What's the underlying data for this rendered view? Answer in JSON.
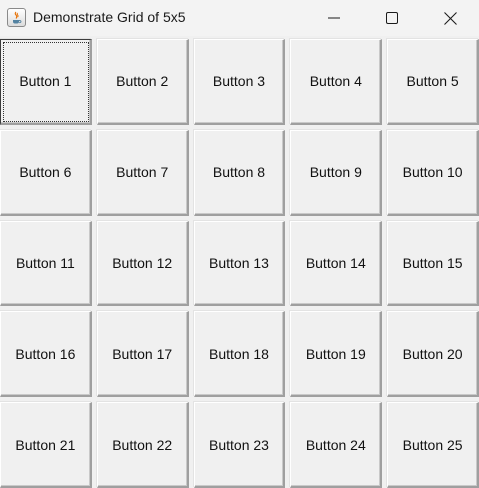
{
  "window": {
    "title": "Demonstrate Grid of 5x5",
    "app_icon": "java-coffee-cup-icon",
    "controls": {
      "minimize": "minimize-icon",
      "maximize": "maximize-icon",
      "close": "close-icon"
    }
  },
  "grid": {
    "rows": 5,
    "columns": 5,
    "focused_index": 0,
    "buttons": [
      {
        "label": "Button 1"
      },
      {
        "label": "Button 2"
      },
      {
        "label": "Button 3"
      },
      {
        "label": "Button 4"
      },
      {
        "label": "Button 5"
      },
      {
        "label": "Button 6"
      },
      {
        "label": "Button 7"
      },
      {
        "label": "Button 8"
      },
      {
        "label": "Button 9"
      },
      {
        "label": "Button 10"
      },
      {
        "label": "Button 11"
      },
      {
        "label": "Button 12"
      },
      {
        "label": "Button 13"
      },
      {
        "label": "Button 14"
      },
      {
        "label": "Button 15"
      },
      {
        "label": "Button 16"
      },
      {
        "label": "Button 17"
      },
      {
        "label": "Button 18"
      },
      {
        "label": "Button 19"
      },
      {
        "label": "Button 20"
      },
      {
        "label": "Button 21"
      },
      {
        "label": "Button 22"
      },
      {
        "label": "Button 23"
      },
      {
        "label": "Button 24"
      },
      {
        "label": "Button 25"
      }
    ]
  },
  "colors": {
    "window_background": "#f0f0f0",
    "titlebar_background": "#f3f3f3",
    "java_icon_red": "#e76f00",
    "java_icon_blue": "#5382a1"
  }
}
